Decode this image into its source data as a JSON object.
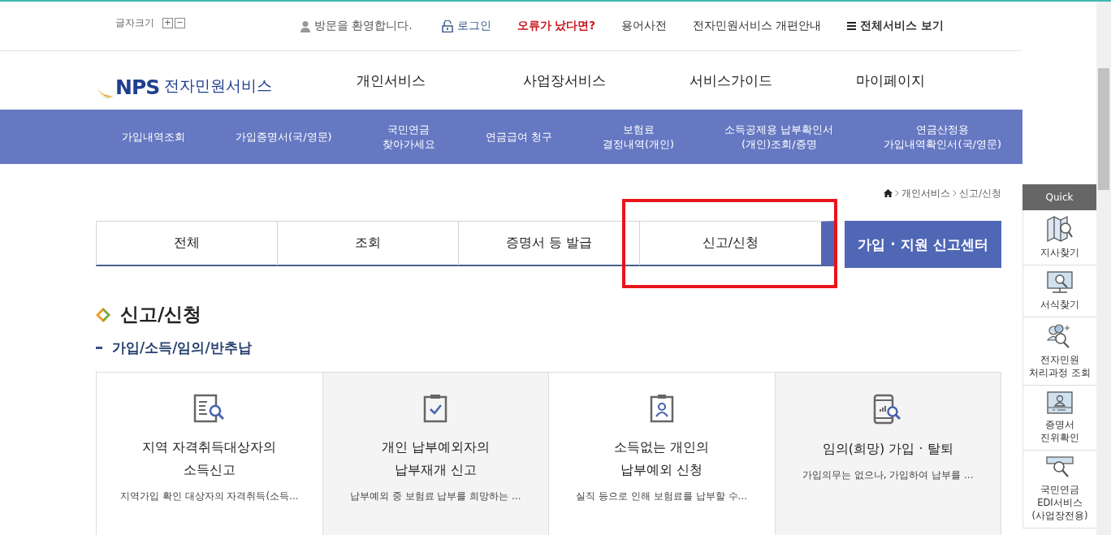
{
  "top_bar": {
    "font_size_label": "글자크기",
    "font_buttons": [
      "+",
      "−"
    ],
    "links": [
      {
        "text": "방문을 환영합니다.",
        "kind": "welcome"
      },
      {
        "text": "로그인",
        "kind": "login"
      },
      {
        "text": "오류가 났다면?",
        "kind": "alert"
      },
      {
        "text": "용어사전",
        "kind": "plain"
      },
      {
        "text": "전자민원서비스 개편안내",
        "kind": "plain"
      },
      {
        "text": "전체서비스 보기",
        "kind": "menu"
      }
    ]
  },
  "logo": {
    "mark": "NPS",
    "name": "전자민원서비스"
  },
  "main_nav": [
    "개인서비스",
    "사업장서비스",
    "서비스가이드",
    "마이페이지"
  ],
  "quick_services": [
    {
      "lines": [
        "가입내역조회"
      ]
    },
    {
      "lines": [
        "가입증명서(국/영문)"
      ]
    },
    {
      "lines": [
        "국민연금",
        "찾아가세요"
      ]
    },
    {
      "lines": [
        "연금급여 청구"
      ]
    },
    {
      "lines": [
        "보험료",
        "결정내역(개인)"
      ]
    },
    {
      "lines": [
        "소득공제용 납부확인서",
        "(개인)조회/증명"
      ]
    },
    {
      "lines": [
        "연금산정용",
        "가입내역확인서(국/영문)"
      ]
    }
  ],
  "breadcrumb": [
    "개인서비스",
    "신고/신청"
  ],
  "tabs": [
    {
      "label": "전체",
      "selected": false,
      "highlighted": false
    },
    {
      "label": "조회",
      "selected": false,
      "highlighted": false
    },
    {
      "label": "증명서 등 발급",
      "selected": false,
      "highlighted": false
    },
    {
      "label": "신고/신청",
      "selected": true,
      "highlighted": true
    }
  ],
  "center_button": "가입 · 지원 신고센터",
  "section_title": "신고/신청",
  "subsection_title": "가입/소득/임의/반추납",
  "cards": [
    {
      "kind": "document-search",
      "title_lines": [
        "지역 자격취득대상자의",
        "소득신고"
      ],
      "description": "지역가입 확인 대상자의 자격취득(소득..."
    },
    {
      "kind": "clipboard-check",
      "title_lines": [
        "개인 납부예외자의",
        "납부재개 신고"
      ],
      "description": "납부예외 중 보험료 납부를 희망하는 ..."
    },
    {
      "kind": "id-badge",
      "title_lines": [
        "소득없는 개인의",
        "납부예외 신청"
      ],
      "description": "실직 등으로 인해 보험료를 납부할 수..."
    },
    {
      "kind": "phone-chart",
      "title_lines": [
        "임의(희망) 가입 · 탈퇴"
      ],
      "description": "가입의무는 없으나, 가입하여 납부를 ..."
    }
  ],
  "quick_menu": {
    "title": "Quick",
    "items": [
      {
        "kind": "map-search",
        "lines": [
          "지사찾기"
        ]
      },
      {
        "kind": "monitor-search",
        "lines": [
          "서식찾기"
        ]
      },
      {
        "kind": "people-search",
        "lines": [
          "전자민원",
          "처리과정 조회"
        ]
      },
      {
        "kind": "certificate",
        "lines": [
          "증명서",
          "진위확인"
        ]
      },
      {
        "kind": "stamp-search",
        "lines": [
          "국민연금",
          "EDI서비스",
          "(사업장전용)"
        ]
      }
    ]
  }
}
